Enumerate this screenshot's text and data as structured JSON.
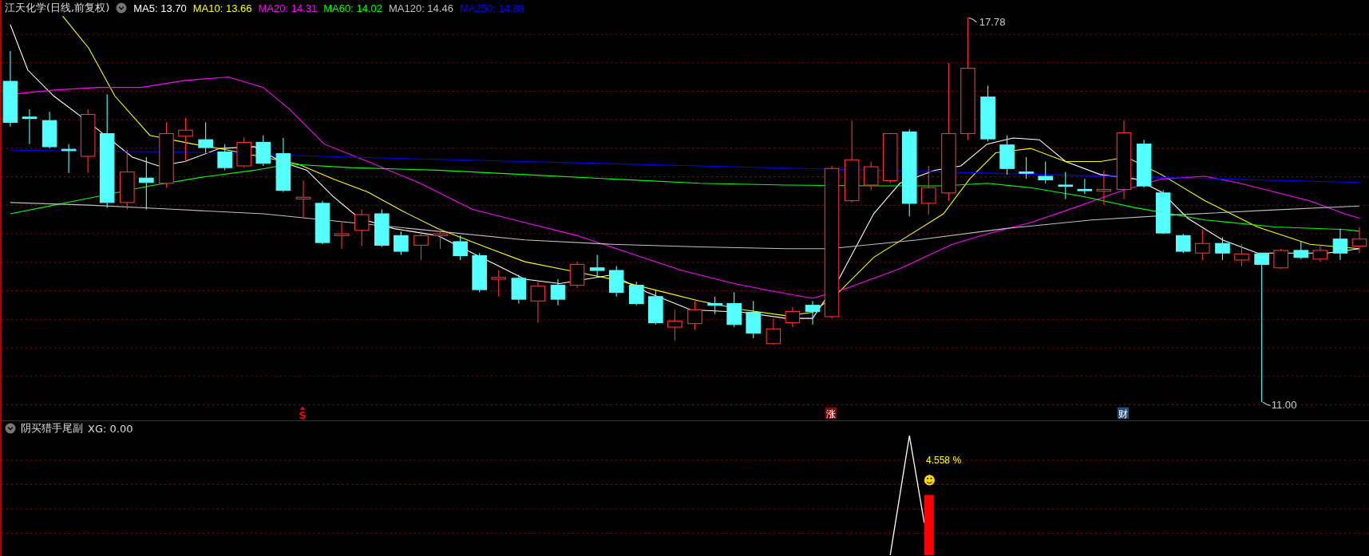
{
  "header": {
    "title": "江天化学(日线,前复权)",
    "moving_averages": [
      {
        "label": "MA5: 13.70",
        "color": "#ffffff"
      },
      {
        "label": "MA10: 13.66",
        "color": "#ffff00"
      },
      {
        "label": "MA20: 14.31",
        "color": "#ff00ff"
      },
      {
        "label": "MA60: 14.02",
        "color": "#00ff00"
      },
      {
        "label": "MA120: 14.46",
        "color": "#c0c0c0"
      },
      {
        "label": "MA250: 14.88",
        "color": "#0000ff"
      }
    ]
  },
  "main_chart": {
    "price_labels": [
      {
        "kind": "high",
        "text": "17.78"
      },
      {
        "kind": "low",
        "text": "11.00"
      }
    ],
    "signals": [
      {
        "kind": "arrow",
        "text": "S",
        "color": "#ff0000"
      },
      {
        "kind": "boxed",
        "text": "涨",
        "color": "#8b0000"
      },
      {
        "kind": "boxed",
        "text": "财",
        "color": "#1f4f7f"
      }
    ]
  },
  "indicator": {
    "name": "阴买猎手尾副",
    "reading": "XG: 0.00",
    "annotation": "4.558 %"
  }
}
